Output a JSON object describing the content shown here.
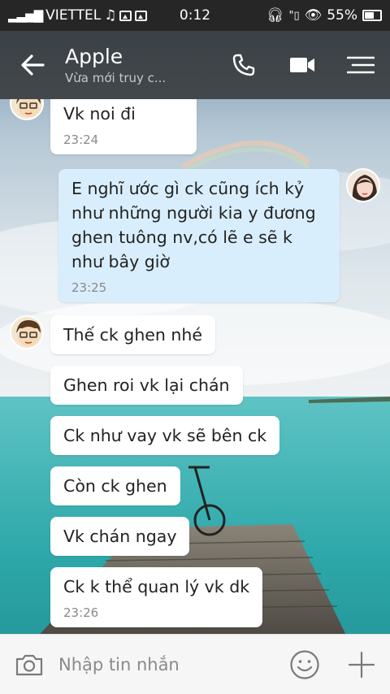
{
  "status_bar": {
    "carrier": "VIETTEL",
    "time": "0:12",
    "battery": "55%",
    "icons": [
      "signal-icon",
      "music-icon",
      "image-icon",
      "image-icon",
      "headset-icon",
      "signal-small-icon",
      "eye-icon",
      "battery-icon"
    ]
  },
  "header": {
    "contact_name": "Apple",
    "status": "Vừa mới truy c...",
    "icons": [
      "back-arrow-icon",
      "phone-icon",
      "video-camera-icon",
      "menu-icon"
    ]
  },
  "messages": [
    {
      "sender": "them",
      "text": "Vk noi đi",
      "time": "23:24"
    },
    {
      "sender": "me",
      "text": "E nghĩ ước gì ck cũng ích kỷ như những người kia y đương ghen tuông nv,có lẽ e sẽ k như bây giờ",
      "time": "23:25"
    },
    {
      "sender": "them",
      "text": "Thế ck ghen nhé"
    },
    {
      "sender": "them",
      "text": "Ghen roi vk lại chán"
    },
    {
      "sender": "them",
      "text": "Ck như vay vk sẽ bên ck"
    },
    {
      "sender": "them",
      "text": "Còn ck ghen"
    },
    {
      "sender": "them",
      "text": "Vk chán ngay"
    },
    {
      "sender": "them",
      "text": "Ck k thể quan lý vk dk",
      "time": "23:26"
    }
  ],
  "input": {
    "placeholder": "Nhập tin nhắn",
    "icons": [
      "camera-icon",
      "emoji-icon",
      "plus-icon"
    ]
  },
  "colors": {
    "header_bg": "#282828",
    "my_bubble": "#d8eefc",
    "their_bubble": "#ffffff",
    "sea": "#3fb4b0"
  }
}
